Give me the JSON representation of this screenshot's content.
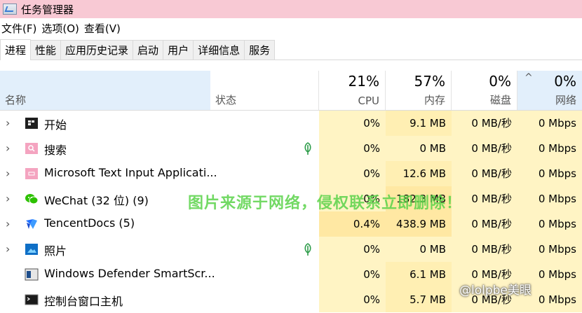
{
  "window": {
    "title": "任务管理器"
  },
  "menu": [
    "文件(F)",
    "选项(O)",
    "查看(V)"
  ],
  "tabs": [
    "进程",
    "性能",
    "应用历史记录",
    "启动",
    "用户",
    "详细信息",
    "服务"
  ],
  "columns": {
    "name": "名称",
    "status": "状态",
    "cpu": {
      "pct": "21%",
      "label": "CPU"
    },
    "memory": {
      "pct": "57%",
      "label": "内存"
    },
    "disk": {
      "pct": "0%",
      "label": "磁盘"
    },
    "network": {
      "pct": "0%",
      "label": "网络"
    }
  },
  "processes": [
    {
      "name": "开始",
      "cpu": "0%",
      "memory": "9.1 MB",
      "disk": "0 MB/秒",
      "network": "0 Mbps",
      "icon": "start-icon"
    },
    {
      "name": "搜索",
      "cpu": "0%",
      "memory": "0 MB",
      "disk": "0 MB/秒",
      "network": "0 Mbps",
      "icon": "search-icon"
    },
    {
      "name": "Microsoft Text Input Applicati...",
      "cpu": "0%",
      "memory": "12.6 MB",
      "disk": "0 MB/秒",
      "network": "0 Mbps",
      "icon": "text-input-icon"
    },
    {
      "name": "WeChat (32 位) (9)",
      "cpu": "0%",
      "memory": "182.3 MB",
      "disk": "0 MB/秒",
      "network": "0 Mbps",
      "icon": "wechat-icon"
    },
    {
      "name": "TencentDocs (5)",
      "cpu": "0.4%",
      "memory": "438.9 MB",
      "disk": "0 MB/秒",
      "network": "0 Mbps",
      "icon": "tencentdocs-icon"
    },
    {
      "name": "照片",
      "cpu": "0%",
      "memory": "0 MB",
      "disk": "0 MB/秒",
      "network": "0 Mbps",
      "icon": "photos-icon"
    },
    {
      "name": "Windows Defender SmartScr...",
      "cpu": "0%",
      "memory": "6.1 MB",
      "disk": "0 MB/秒",
      "network": "0 Mbps",
      "icon": "defender-icon"
    },
    {
      "name": "控制台窗口主机",
      "cpu": "0%",
      "memory": "5.7 MB",
      "disk": "0 MB/秒",
      "network": "0 Mbps",
      "icon": "console-icon"
    }
  ],
  "overlay": {
    "watermark": "图片来源于网络，侵权联系立即删除！",
    "credit": "@lolpbe美眼"
  }
}
